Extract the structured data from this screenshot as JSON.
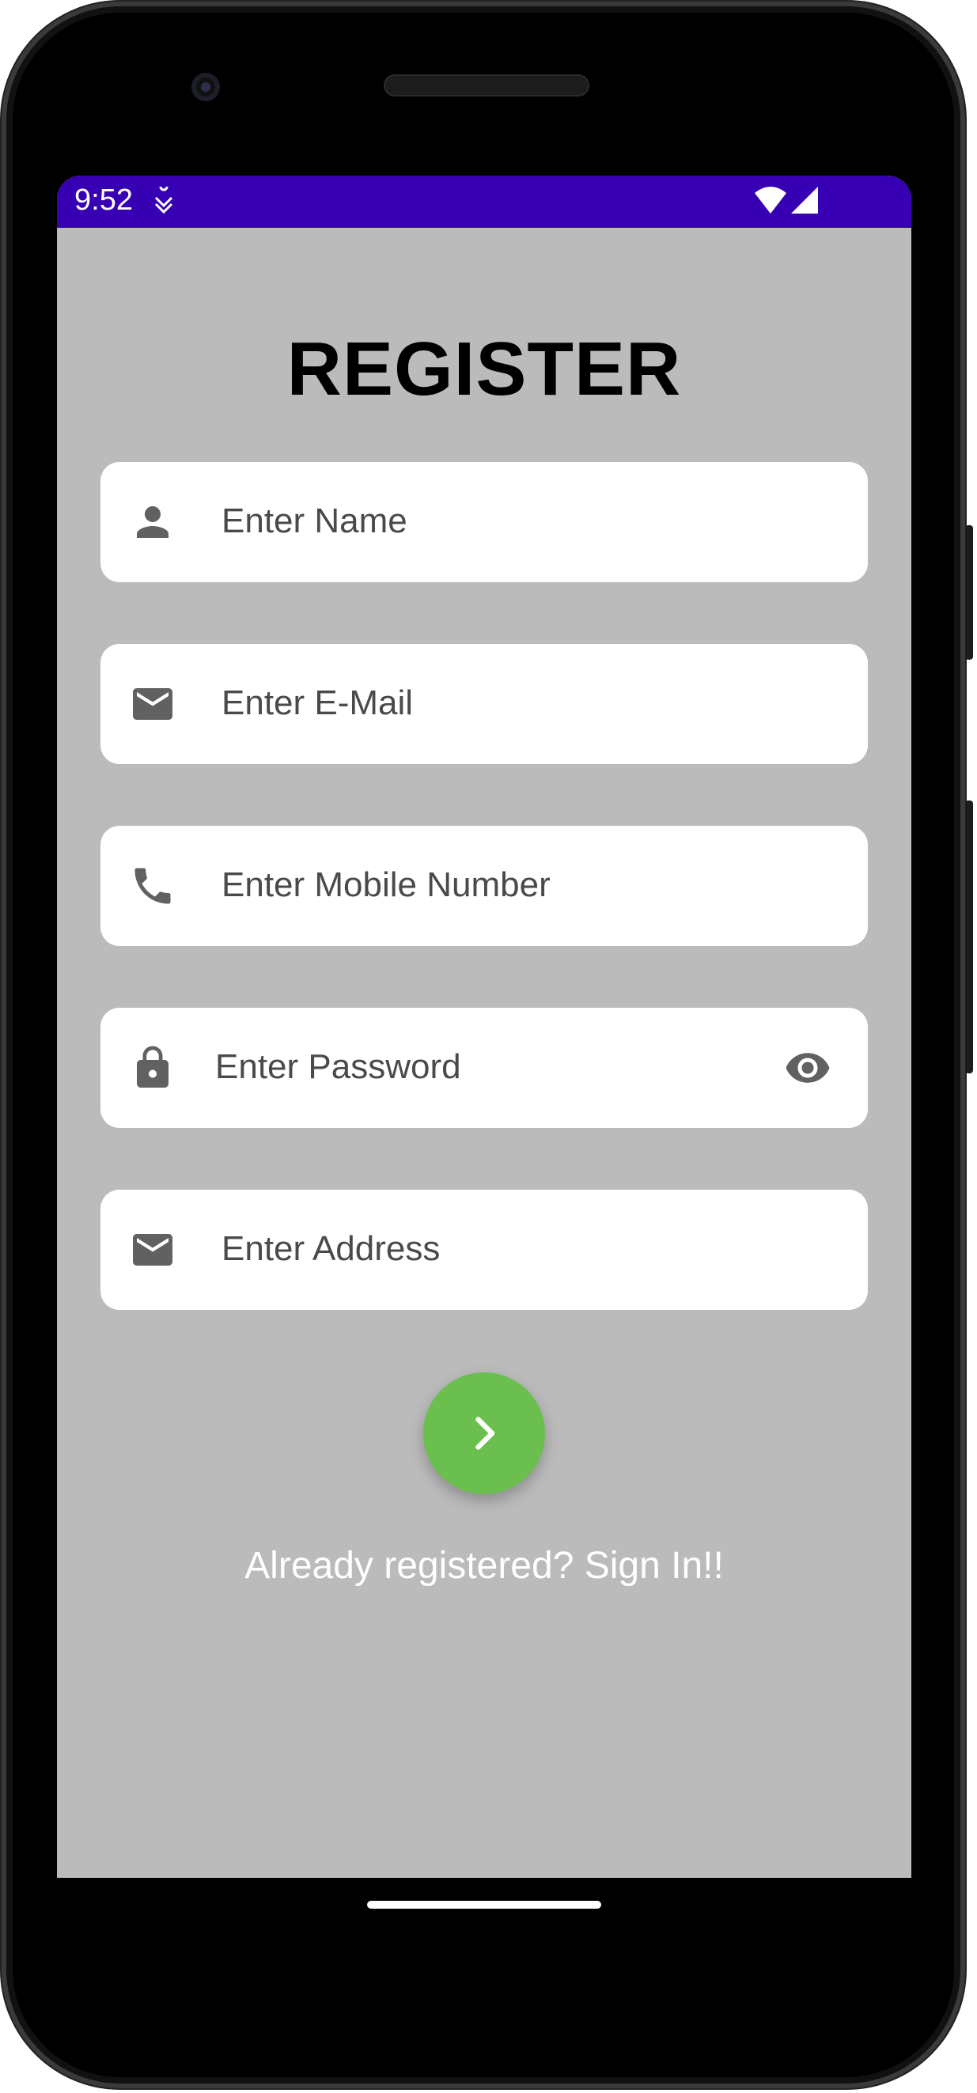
{
  "status_bar": {
    "time": "9:52",
    "color": "#3700b3",
    "icons": [
      "app-notification-icon",
      "wifi-icon",
      "cell-signal-icon"
    ]
  },
  "page": {
    "title": "REGISTER",
    "background": "#bbbbbb"
  },
  "form": {
    "name_placeholder": "Enter Name",
    "email_placeholder": "Enter E-Mail",
    "mobile_placeholder": "Enter Mobile Number",
    "password_placeholder": "Enter Password",
    "address_placeholder": "Enter Address",
    "field_icons": [
      "person-icon",
      "mail-icon",
      "phone-icon",
      "lock-icon",
      "mail-icon"
    ]
  },
  "actions": {
    "submit_color": "#6bbf4e",
    "submit_icon": "chevron-right-icon",
    "signin_link": "Already registered? Sign In!!"
  }
}
